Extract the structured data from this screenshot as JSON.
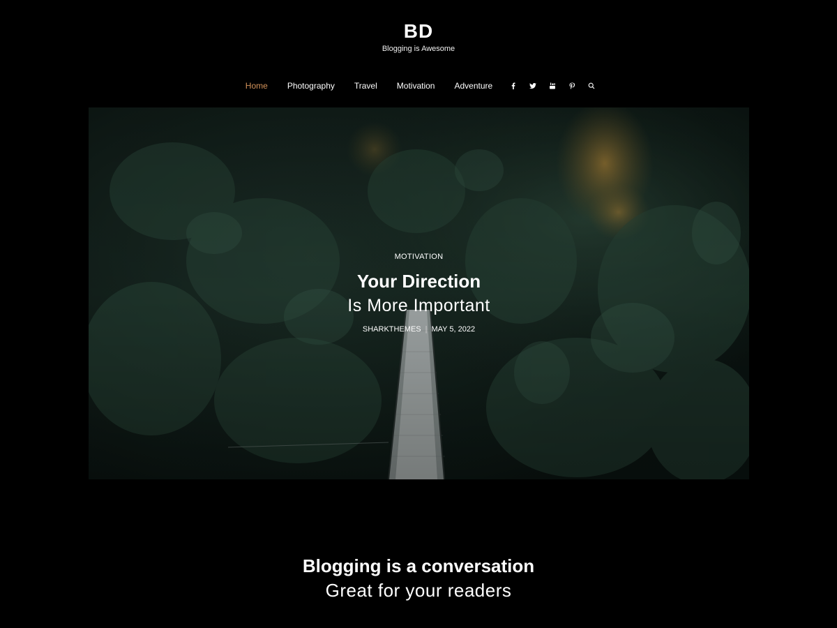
{
  "site": {
    "title": "BD",
    "tagline": "Blogging is Awesome"
  },
  "nav": {
    "items": [
      {
        "label": "Home",
        "active": true
      },
      {
        "label": "Photography",
        "active": false
      },
      {
        "label": "Travel",
        "active": false
      },
      {
        "label": "Motivation",
        "active": false
      },
      {
        "label": "Adventure",
        "active": false
      }
    ],
    "icons": [
      "facebook-icon",
      "twitter-icon",
      "youtube-icon",
      "pinterest-icon",
      "search-icon"
    ],
    "active_color": "#d4935a"
  },
  "hero": {
    "category": "MOTIVATION",
    "title_line1": "Your Direction",
    "title_line2": "Is More Important",
    "author": "SHARKTHEMES",
    "date": "MAY 5, 2022"
  },
  "section": {
    "title": "Blogging is a conversation",
    "subtitle": "Great for your readers"
  }
}
